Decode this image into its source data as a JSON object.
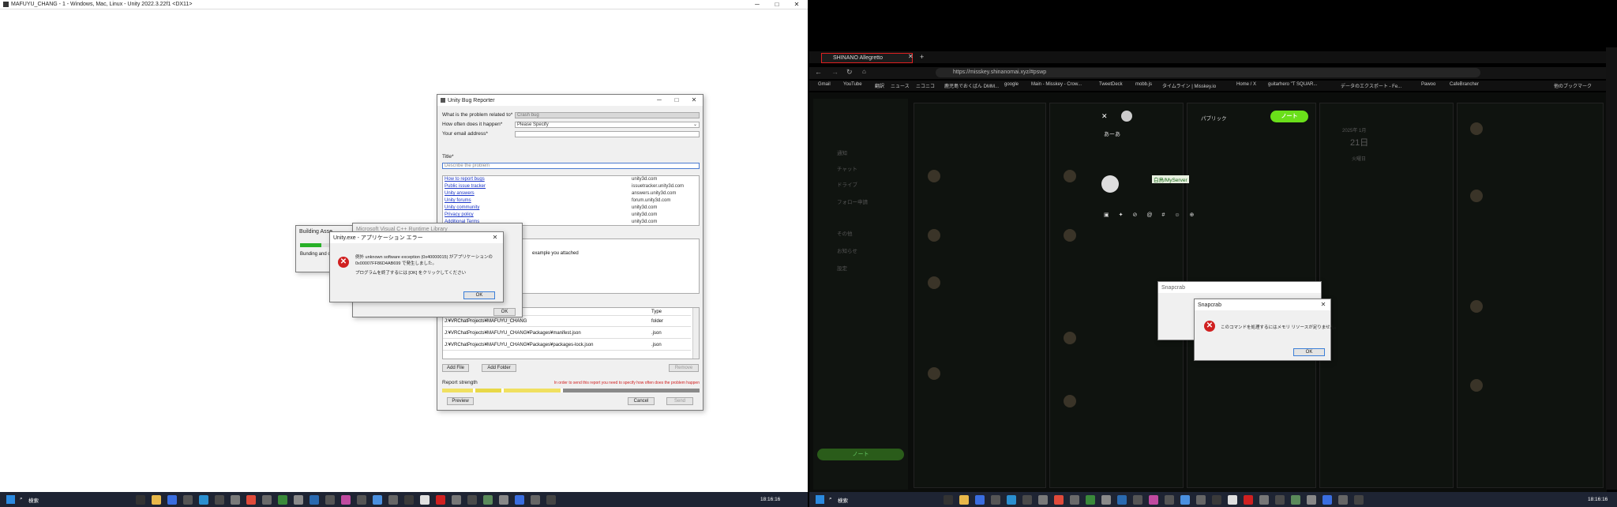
{
  "left": {
    "unity_title": "MAFUYU_CHANG - 1 - Windows, Mac, Linux - Unity 2022.3.22f1 <DX11>",
    "bug_reporter": {
      "title": "Unity Bug Reporter",
      "problem_label": "What is the problem related to*",
      "problem_value": "Crash bug",
      "often_label": "How often does it happen*",
      "often_value": "Please Specify",
      "email_label": "Your email address*",
      "title_label": "Title*",
      "title_placeholder": "Describe the problem",
      "links": [
        {
          "label": "How to report bugs",
          "url": "unity3d.com"
        },
        {
          "label": "Public issue tracker",
          "url": "issuetracker.unity3d.com"
        },
        {
          "label": "Unity answers",
          "url": "answers.unity3d.com"
        },
        {
          "label": "Unity forums",
          "url": "forum.unity3d.com"
        },
        {
          "label": "Unity community",
          "url": "unity3d.com"
        },
        {
          "label": "Privacy policy",
          "url": "unity3d.com"
        },
        {
          "label": "Additional Terms",
          "url": "unity3d.com"
        }
      ],
      "desc_partial": "example you attached",
      "type_header": "Type",
      "files": [
        {
          "path": "J:¥VRChatProjects¥MAFUYU_CHANG",
          "type": "folder"
        },
        {
          "path": "J:¥VRChatProjects¥MAFUYU_CHANG¥Packages¥manifest.json",
          "type": ".json"
        },
        {
          "path": "J:¥VRChatProjects¥MAFUYU_CHANG¥Packages¥packages-lock.json",
          "type": ".json"
        }
      ],
      "add_file": "Add File",
      "add_folder": "Add Folder",
      "remove": "Remove",
      "strength_label": "Report strength",
      "strength_note": "In order to send this report you need to specify how often does the problem happen",
      "preview": "Preview",
      "cancel": "Cancel",
      "send": "Send"
    },
    "building_title": "Building Asse",
    "building_text": "Bunding and c",
    "vcpp_title": "Microsoft Visual C++ Runtime Library",
    "vcpp_ok": "OK",
    "error": {
      "title": "Unity.exe - アプリケーション エラー",
      "line1": "例外 unknown software exception (0x40000015) がアプリケーションの",
      "line2": "0x00007FF86D4AB699 で発生しました。",
      "line3": "プログラムを終了するには [OK] をクリックしてください",
      "ok": "OK"
    },
    "taskbar": {
      "search": "検索",
      "time": "18:16:16"
    }
  },
  "right": {
    "tab_title": "SHINANO Allegretto",
    "url": "https://misskey.shinanomai.xyz/#pswp",
    "bookmarks": [
      "Gmail",
      "YouTube",
      "翻訳",
      "ニュース",
      "ニコニコ",
      "鹿児島でおくばん DMM...",
      "google",
      "Main - Misskey - Crow...",
      "TweetDeck",
      "mobb.js",
      "タイムライン | Misskey.io",
      "Home / X",
      "guitarhero \"T SQUAR...",
      "データのエクスポート - Fe...",
      "Pawoo",
      "CafeBrancher",
      "他のブックマーク"
    ],
    "nav": [
      "通知",
      "チャット",
      "ドライブ",
      "フォロー申請",
      "その他",
      "お知らせ",
      "設定"
    ],
    "note_button": "ノート",
    "compose_publish": "ノート",
    "compose_visibility": "パブリック",
    "compose_text": "あーあ",
    "server_badge": "白鳥/MyServer",
    "snap_back_title": "Snapcrab",
    "snap_front_title": "Snapcrab",
    "snap_message": "このコマンドを処理するにはメモリ リソースが足りません。",
    "snap_ok": "OK",
    "date_year": "2025年 1月",
    "date_day": "21日",
    "date_weekday": "火曜日",
    "taskbar": {
      "search": "検索",
      "time": "18:16:16"
    }
  }
}
